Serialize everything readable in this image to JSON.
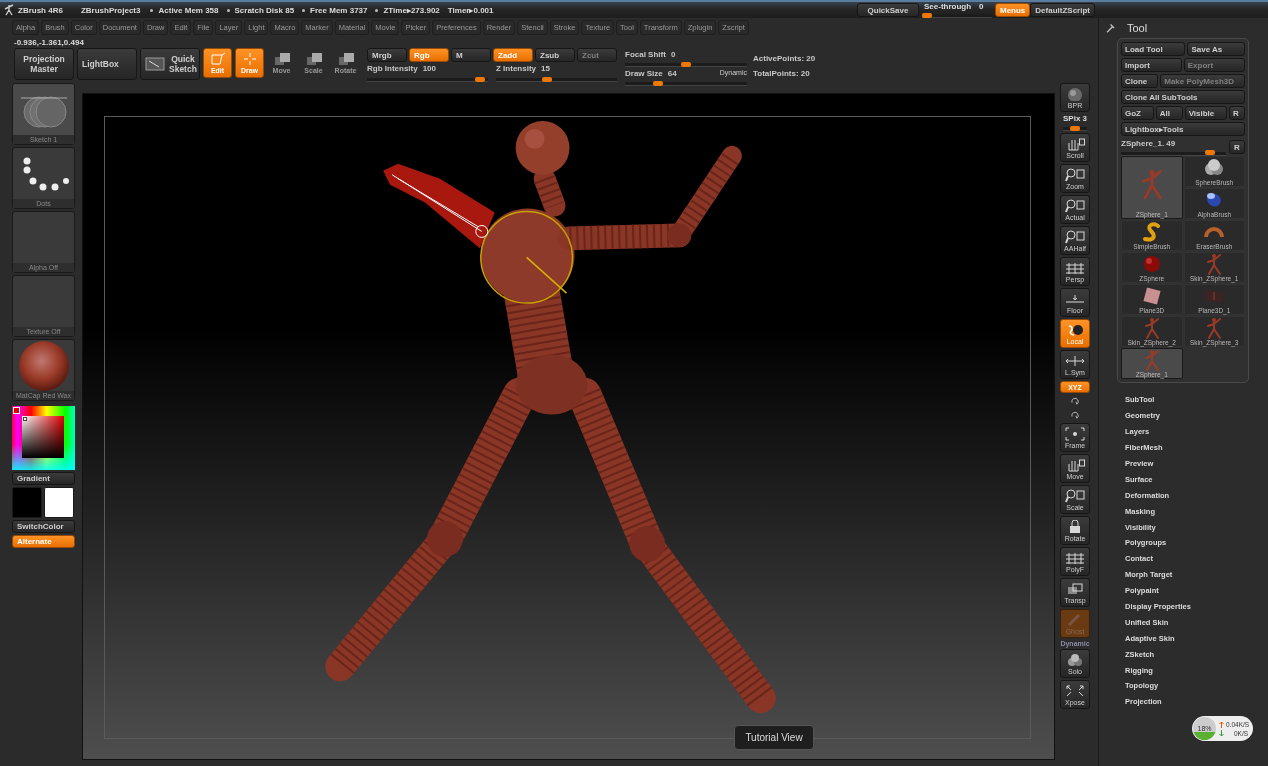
{
  "title_bar": {
    "app": "ZBrush 4R6",
    "project": "ZBrushProject3",
    "stats": [
      {
        "text": "Active Mem 358",
        "bullet": true
      },
      {
        "text": "Scratch Disk 85",
        "bullet": true
      },
      {
        "text": "Free Mem 3737",
        "bullet": true
      },
      {
        "text": "ZTime▸273.902",
        "bullet": true
      },
      {
        "text": "Timer▸0.001",
        "bullet": false
      }
    ],
    "quicksave": "QuickSave",
    "see_through": {
      "label": "See-through",
      "value": "0",
      "level": 0
    },
    "menus": {
      "label": "Menus",
      "on": true
    },
    "script": "DefaultZScript"
  },
  "menu_bar": [
    "Alpha",
    "Brush",
    "Color",
    "Document",
    "Draw",
    "Edit",
    "File",
    "Layer",
    "Light",
    "Macro",
    "Marker",
    "Material",
    "Movie",
    "Picker",
    "Preferences",
    "Render",
    "Stencil",
    "Stroke",
    "Texture",
    "Tool",
    "Transform",
    "Zplugin",
    "Zscript"
  ],
  "coordinates": "-0.936,-1.361,0.494",
  "top_shelf": {
    "buttons": [
      {
        "label": "Projection Master",
        "kind": "wide",
        "on": false
      },
      {
        "label": "LightBox",
        "kind": "wide",
        "on": false
      },
      {
        "label": "Quick Sketch",
        "kind": "wide",
        "on": false
      },
      {
        "label": "Edit",
        "kind": "tool",
        "on": true
      },
      {
        "label": "Draw",
        "kind": "tool",
        "on": true
      },
      {
        "label": "Move",
        "kind": "tool",
        "on": false
      },
      {
        "label": "Scale",
        "kind": "tool",
        "on": false
      },
      {
        "label": "Rotate",
        "kind": "tool",
        "on": false
      }
    ],
    "modes": [
      {
        "label": "Mrgb",
        "on": false,
        "disabled": false
      },
      {
        "label": "Rgb",
        "on": true,
        "disabled": false
      },
      {
        "label": "M",
        "on": false,
        "disabled": false
      },
      {
        "label": "Zadd",
        "on": true,
        "disabled": false
      },
      {
        "label": "Zsub",
        "on": false,
        "disabled": false
      },
      {
        "label": "Zcut",
        "on": false,
        "disabled": true
      }
    ],
    "sliders": [
      {
        "label": "Rgb Intensity",
        "value": "100",
        "level": 0.97
      },
      {
        "label": "Z Intensity",
        "value": "15",
        "level": 0.41
      }
    ],
    "focal_shift": {
      "label": "Focal Shift",
      "value": "0",
      "level": 0.5
    },
    "draw_size": {
      "label": "Draw Size",
      "value": "64",
      "level": 0.25,
      "dynamic": "Dynamic"
    },
    "points": [
      "ActivePoints: 20",
      "TotalPoints: 20"
    ]
  },
  "left_shelf": {
    "thumbnails": [
      {
        "kind": "sketch",
        "label": "Sketch 1"
      },
      {
        "kind": "dots",
        "label": "Dots"
      },
      {
        "kind": "empty",
        "label": "Alpha Off"
      },
      {
        "kind": "empty",
        "label": "Texture Off"
      },
      {
        "kind": "material",
        "label": "MatCap Red Wax"
      }
    ],
    "gradient": "Gradient",
    "swatches": [
      {
        "color": "#000000"
      },
      {
        "color": "#ffffff"
      }
    ],
    "switch_color": "SwitchColor",
    "alternate": {
      "label": "Alternate",
      "on": true
    }
  },
  "canvas": {
    "tutorial_view": "Tutorial View"
  },
  "right_shelf": [
    {
      "kind": "button",
      "label": "BPR",
      "on": false,
      "disabled": false
    },
    {
      "kind": "slider",
      "label": "SPix 3",
      "level": 0.5
    },
    {
      "kind": "button",
      "label": "Scroll",
      "on": false,
      "disabled": false
    },
    {
      "kind": "button",
      "label": "Zoom",
      "on": false,
      "disabled": false
    },
    {
      "kind": "button",
      "label": "Actual",
      "on": false,
      "disabled": false
    },
    {
      "kind": "button",
      "label": "AAHalf",
      "on": false,
      "disabled": false
    },
    {
      "kind": "button",
      "label": "Persp",
      "on": false,
      "disabled": false
    },
    {
      "kind": "button",
      "label": "Floor",
      "on": false,
      "disabled": false
    },
    {
      "kind": "button",
      "label": "Local",
      "on": true,
      "disabled": false
    },
    {
      "kind": "button",
      "label": "L.Sym",
      "on": false,
      "disabled": false
    },
    {
      "kind": "toggle",
      "label": "XYZ",
      "on": true
    },
    {
      "kind": "mini"
    },
    {
      "kind": "mini"
    },
    {
      "kind": "button",
      "label": "Frame",
      "on": false,
      "disabled": false
    },
    {
      "kind": "button",
      "label": "Move",
      "on": false,
      "disabled": false
    },
    {
      "kind": "button",
      "label": "Scale",
      "on": false,
      "disabled": false
    },
    {
      "kind": "button",
      "label": "Rotate",
      "on": false,
      "disabled": false
    },
    {
      "kind": "button",
      "label": "PolyF",
      "on": false,
      "disabled": false
    },
    {
      "kind": "button",
      "label": "Transp",
      "on": false,
      "disabled": false
    },
    {
      "kind": "button",
      "label": "Ghost",
      "on": true,
      "disabled": true
    },
    {
      "kind": "caption",
      "label": "Dynamic"
    },
    {
      "kind": "button",
      "label": "Solo",
      "on": false,
      "disabled": false
    },
    {
      "kind": "button",
      "label": "Xpose",
      "on": false,
      "disabled": false
    }
  ],
  "tool_palette": {
    "title": "Tool",
    "button_rows": [
      [
        {
          "label": "Load Tool",
          "disabled": false
        },
        {
          "label": "Save As",
          "disabled": false
        }
      ],
      [
        {
          "label": "Import",
          "disabled": false
        },
        {
          "label": "Export",
          "disabled": true
        }
      ],
      [
        {
          "label": "Clone",
          "disabled": false
        },
        {
          "label": "Make PolyMesh3D",
          "disabled": true
        }
      ],
      [
        {
          "label": "Clone All SubTools",
          "disabled": false
        }
      ],
      [
        {
          "label": "GoZ",
          "disabled": false
        },
        {
          "label": "All",
          "disabled": false
        },
        {
          "label": "Visible",
          "disabled": false
        },
        {
          "label": "R",
          "disabled": false
        }
      ],
      [
        {
          "label": "Lightbox▸Tools",
          "disabled": false
        }
      ]
    ],
    "subtool_slider": {
      "label": "ZSphere_1. 49",
      "level": 0.88,
      "reset": "R"
    },
    "tools": [
      {
        "label": "SphereBrush",
        "kind": "tool",
        "selected": false
      },
      {
        "label": "ZSphere_1",
        "kind": "current",
        "selected": true
      },
      {
        "label": "AlphaBrush",
        "kind": "tool",
        "selected": false
      },
      {
        "label": "SimpleBrush",
        "kind": "tool",
        "selected": false
      },
      {
        "label": "EraserBrush",
        "kind": "tool",
        "selected": false
      },
      {
        "label": "ZSphere",
        "kind": "tool",
        "selected": false
      },
      {
        "label": "Skin_ZSphere_1",
        "kind": "tool",
        "selected": false
      },
      {
        "label": "Plane3D",
        "kind": "tool",
        "selected": false
      },
      {
        "label": "Plane3D_1",
        "kind": "tool",
        "selected": false
      },
      {
        "label": "Skin_ZSphere_2",
        "kind": "tool",
        "selected": false
      },
      {
        "label": "Skin_ZSphere_3",
        "kind": "tool",
        "selected": false
      },
      {
        "label": "ZSphere_1",
        "kind": "tool",
        "selected": true
      }
    ],
    "subpalettes": [
      "SubTool",
      "Geometry",
      "Layers",
      "FiberMesh",
      "Preview",
      "Surface",
      "Deformation",
      "Masking",
      "Visibility",
      "Polygroups",
      "Contact",
      "Morph Target",
      "Polypaint",
      "Display Properties",
      "Unified Skin",
      "Adaptive Skin",
      "ZSketch",
      "Rigging",
      "Topology",
      "Projection"
    ]
  },
  "net_monitor": {
    "cpu": "18%",
    "upload": "0.04K/S",
    "download": "0K/S"
  }
}
